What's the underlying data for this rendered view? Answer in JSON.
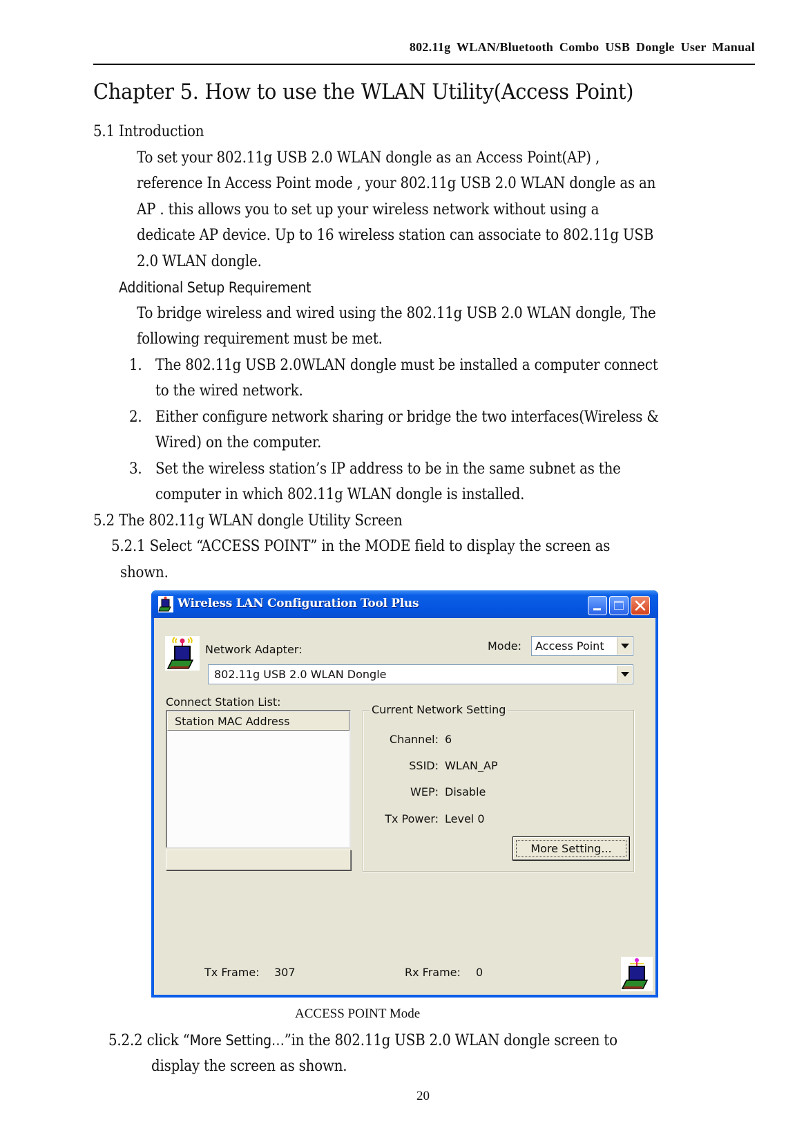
{
  "page": {
    "header": "802.11g  WLAN/Bluetooth  Combo  USB  Dongle  User  Manual",
    "chapter_title": "Chapter 5. How to use the WLAN Utility(Access Point)",
    "section_5_1": {
      "heading": "5.1 Introduction",
      "intro_lines": [
        "To set your 802.11g USB 2.0 WLAN dongle as an Access Point(AP) ,",
        "reference In Access Point mode , your 802.11g USB 2.0 WLAN dongle as an",
        "AP . this allows you to set up your wireless network without using a",
        "dedicate AP device. Up to 16 wireless station can associate to 802.11g USB",
        "2.0 WLAN dongle."
      ],
      "subheading": "Additional Setup Requirement",
      "req_lines": [
        "To bridge wireless and wired using the 802.11g USB 2.0 WLAN dongle, The",
        "following requirement must be met."
      ],
      "list": [
        {
          "num": "1.",
          "lines": [
            "The 802.11g USB 2.0WLAN dongle must be installed a computer connect",
            "to the wired network."
          ]
        },
        {
          "num": "2.",
          "lines": [
            "Either configure network sharing or bridge the two interfaces(Wireless &",
            "Wired) on the computer."
          ]
        },
        {
          "num": "3.",
          "lines": [
            "Set the wireless station’s IP address to be in the same subnet as the",
            "computer in which 802.11g WLAN dongle is installed."
          ]
        }
      ]
    },
    "section_5_2": {
      "heading": "5.2 The 802.11g WLAN dongle Utility Screen",
      "step_5_2_1": [
        "5.2.1 Select “ACCESS POINT” in the MODE field to display the screen as",
        "shown."
      ],
      "figure_caption": "ACCESS POINT Mode",
      "step_5_2_2_prefix": "5.2.2 click “",
      "step_5_2_2_link": "More Setting…",
      "step_5_2_2_suffix": "”in the 802.11g USB 2.0 WLAN dongle screen to",
      "step_5_2_2_line2": "display the screen as shown."
    },
    "page_number": "20"
  },
  "dialog": {
    "title": "Wireless LAN Configuration Tool Plus",
    "icons": {
      "app": "wireless-laptop-icon",
      "minimize": "minimize-icon",
      "maximize": "maximize-icon",
      "close": "close-icon",
      "adapter": "wireless-adapter-icon",
      "status": "wireless-status-icon"
    },
    "network_adapter_label": "Network Adapter:",
    "mode_label": "Mode:",
    "mode_value": "Access Point",
    "adapter_value": "802.11g USB 2.0 WLAN Dongle",
    "station_list_label": "Connect Station List:",
    "station_list_header": "Station MAC Address",
    "stations": [],
    "group_title": "Current Network Setting",
    "settings": [
      {
        "label": "Channel:",
        "value": "6"
      },
      {
        "label": "SSID:",
        "value": "WLAN_AP"
      },
      {
        "label": "WEP:",
        "value": "Disable"
      },
      {
        "label": "Tx Power:",
        "value": "Level 0"
      }
    ],
    "more_setting_button": "More Setting...",
    "tx_frame_label": "Tx Frame:",
    "tx_frame_value": "307",
    "rx_frame_label": "Rx Frame:",
    "rx_frame_value": "0",
    "colors": {
      "titlebar": "#0554e0",
      "client": "#ece9d8",
      "close": "#d6421c"
    }
  }
}
